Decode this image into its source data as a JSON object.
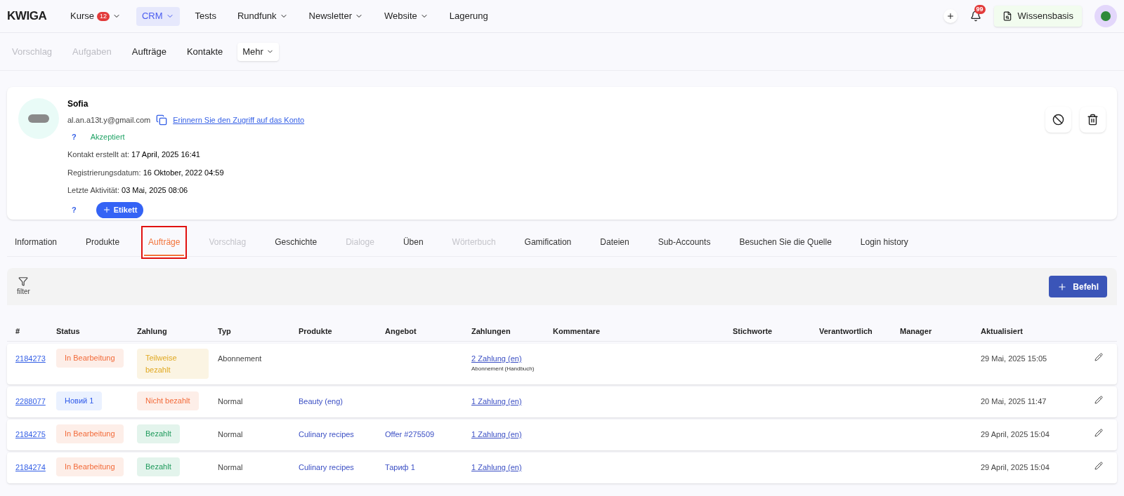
{
  "top_nav": {
    "logo": "KWIGA",
    "items": [
      {
        "label": "Kurse",
        "badge": "12",
        "dropdown": true,
        "selected": false
      },
      {
        "label": "CRM",
        "dropdown": true,
        "selected": true
      },
      {
        "label": "Tests",
        "dropdown": false,
        "selected": false
      },
      {
        "label": "Rundfunk",
        "dropdown": true,
        "selected": false
      },
      {
        "label": "Newsletter",
        "dropdown": true,
        "selected": false
      },
      {
        "label": "Website",
        "dropdown": true,
        "selected": false
      },
      {
        "label": "Lagerung",
        "dropdown": false,
        "selected": false
      }
    ],
    "notification_count": "99",
    "knowledge_button": "Wissensbasis"
  },
  "sub_nav": {
    "items": [
      {
        "label": "Vorschlag",
        "disabled": true
      },
      {
        "label": "Aufgaben",
        "disabled": true
      },
      {
        "label": "Aufträge",
        "disabled": false
      },
      {
        "label": "Kontakte",
        "disabled": false
      }
    ],
    "more": "Mehr"
  },
  "contact": {
    "name": "Sofia",
    "email": "al.an.a13t.y@gmail.com",
    "remind_link": "Erinnern Sie den Zugriff auf das Konto",
    "help_mark": "?",
    "status": "Akzeptiert",
    "details": [
      {
        "label": "Kontakt erstellt at:",
        "value": "17 April, 2025 16:41"
      },
      {
        "label": "Registrierungsdatum:",
        "value": "16 Oktober, 2022 04:59"
      },
      {
        "label": "Letzte Aktivität:",
        "value": "03 Mai, 2025 08:06"
      }
    ],
    "tag_help_mark": "?",
    "tag_button": "Etikett"
  },
  "tabs": [
    {
      "label": "Information",
      "selected": false,
      "disabled": false,
      "highlighted": false
    },
    {
      "label": "Produkte",
      "selected": false,
      "disabled": false,
      "highlighted": false
    },
    {
      "label": "Aufträge",
      "selected": true,
      "disabled": false,
      "highlighted": true
    },
    {
      "label": "Vorschlag",
      "selected": false,
      "disabled": true,
      "highlighted": false
    },
    {
      "label": "Geschichte",
      "selected": false,
      "disabled": false,
      "highlighted": false
    },
    {
      "label": "Dialoge",
      "selected": false,
      "disabled": true,
      "highlighted": false
    },
    {
      "label": "Üben",
      "selected": false,
      "disabled": false,
      "highlighted": false
    },
    {
      "label": "Wörterbuch",
      "selected": false,
      "disabled": true,
      "highlighted": false
    },
    {
      "label": "Gamification",
      "selected": false,
      "disabled": false,
      "highlighted": false
    },
    {
      "label": "Dateien",
      "selected": false,
      "disabled": false,
      "highlighted": false
    },
    {
      "label": "Sub-Accounts",
      "selected": false,
      "disabled": false,
      "highlighted": false
    },
    {
      "label": "Besuchen Sie die Quelle",
      "selected": false,
      "disabled": false,
      "highlighted": false
    },
    {
      "label": "Login history",
      "selected": false,
      "disabled": false,
      "highlighted": false
    }
  ],
  "toolbar": {
    "filter": "filter",
    "add_button": "Befehl"
  },
  "table": {
    "columns": [
      "#",
      "Status",
      "Zahlung",
      "Typ",
      "Produkte",
      "Angebot",
      "Zahlungen",
      "Kommentare",
      "Stichworte",
      "Verantwortlich",
      "Manager",
      "Aktualisiert"
    ],
    "rows": [
      {
        "id": "2184273",
        "status": {
          "text": "In Bearbeitung",
          "kind": "processing"
        },
        "payment": {
          "text": "Teilweise bezahlt",
          "kind": "partial"
        },
        "type": "Abonnement",
        "product": "",
        "offer": "",
        "payments": "2 Zahlung (en)",
        "payments_note": "Abonnement (Handbuch)",
        "updated": "29 Mai, 2025 15:05"
      },
      {
        "id": "2288077",
        "status": {
          "text": "Новий 1",
          "kind": "new"
        },
        "payment": {
          "text": "Nicht bezahlt",
          "kind": "unpaid"
        },
        "type": "Normal",
        "product": "Beauty (eng)",
        "offer": "",
        "payments": "1 Zahlung (en)",
        "payments_note": "",
        "updated": "20 Mai, 2025 11:47"
      },
      {
        "id": "2184275",
        "status": {
          "text": "In Bearbeitung",
          "kind": "processing"
        },
        "payment": {
          "text": "Bezahlt",
          "kind": "paid"
        },
        "type": "Normal",
        "product": "Culinary recipes",
        "offer": "Offer #275509",
        "payments": "1 Zahlung (en)",
        "payments_note": "",
        "updated": "29 April, 2025 15:04"
      },
      {
        "id": "2184274",
        "status": {
          "text": "In Bearbeitung",
          "kind": "processing"
        },
        "payment": {
          "text": "Bezahlt",
          "kind": "paid"
        },
        "type": "Normal",
        "product": "Culinary recipes",
        "offer": "Тариф 1",
        "payments": "1 Zahlung (en)",
        "payments_note": "",
        "updated": "29 April, 2025 15:04"
      }
    ]
  }
}
